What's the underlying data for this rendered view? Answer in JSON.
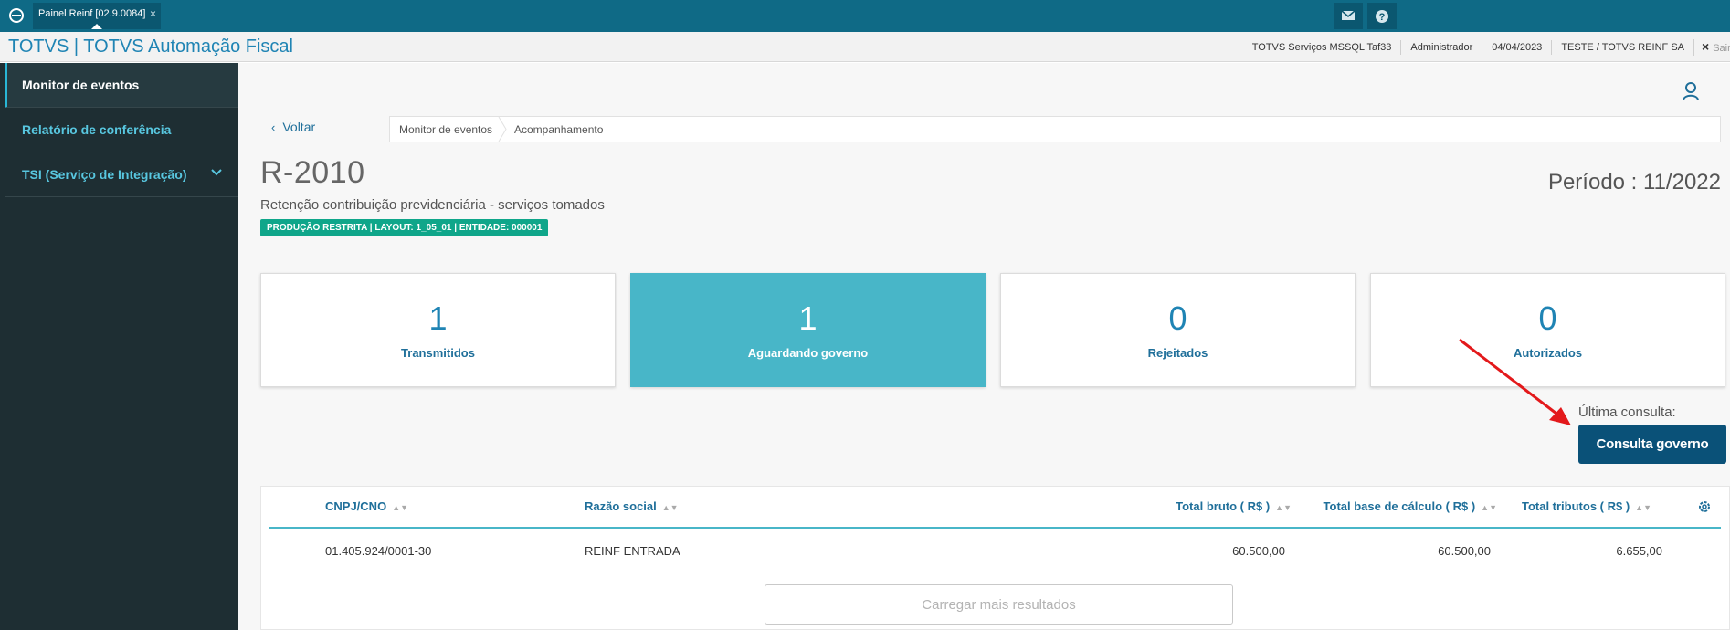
{
  "topbar": {
    "tab_label": "Painel Reinf [02.9.0084]",
    "tab_close": "×",
    "icons": [
      "logo-icon",
      "mail-icon",
      "help-icon"
    ]
  },
  "appbar": {
    "title": "TOTVS | TOTVS Automação Fiscal",
    "environment": "TOTVS Serviços MSSQL Taf33",
    "user": "Administrador",
    "date": "04/04/2023",
    "company": "TESTE / TOTVS REINF SA",
    "exit_icon": "×",
    "exit_label": "Sair"
  },
  "sidebar": {
    "items": [
      {
        "label": "Monitor de eventos"
      },
      {
        "label": "Relatório de conferência"
      },
      {
        "label": "TSI (Serviço de Integração)"
      }
    ]
  },
  "main": {
    "back_label": "Voltar",
    "breadcrumb": [
      "Monitor de eventos",
      "Acompanhamento"
    ],
    "event_code": "R-2010",
    "event_description": "Retenção contribuição previdenciária - serviços tomados",
    "badge": "PRODUÇÃO RESTRITA | LAYOUT: 1_05_01 | ENTIDADE: 000001",
    "periodo": "Período : 11/2022",
    "cards": [
      {
        "value": "1",
        "label": "Transmitidos"
      },
      {
        "value": "1",
        "label": "Aguardando governo"
      },
      {
        "value": "0",
        "label": "Rejeitados"
      },
      {
        "value": "0",
        "label": "Autorizados"
      }
    ],
    "ultima_consulta": "Última consulta:",
    "consulta_button": "Consulta governo",
    "table": {
      "columns": [
        "CNPJ/CNO",
        "Razão social",
        "Total bruto ( R$ )",
        "Total base de cálculo ( R$ )",
        "Total tributos ( R$ )"
      ],
      "rows": [
        {
          "cnpj": "01.405.924/0001-30",
          "razao": "REINF ENTRADA",
          "bruto": "60.500,00",
          "base": "60.500,00",
          "tributos": "6.655,00"
        }
      ]
    },
    "load_more": "Carregar mais resultados"
  },
  "colors": {
    "topbar": "#0f6a86",
    "brand": "#1f84b4",
    "sidebar": "#1e2e33",
    "active_card": "#48b6c8",
    "primary_button": "#0a5178",
    "badge": "#0fa68a",
    "annotation_arrow": "#e3191b"
  }
}
